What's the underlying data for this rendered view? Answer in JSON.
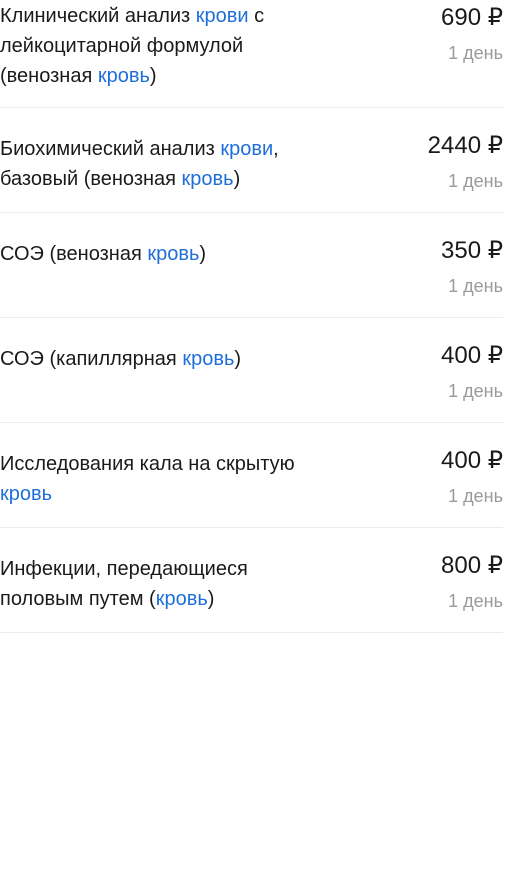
{
  "items": [
    {
      "title_parts": [
        "Клинический анализ ",
        "крови",
        " с лейкоцитарной формулой (венозная ",
        "кровь",
        ")"
      ],
      "price": "690 ₽",
      "duration": "1 день"
    },
    {
      "title_parts": [
        "Биохимический анализ ",
        "крови",
        ", базовый (венозная ",
        "кровь",
        ")"
      ],
      "price": "2440 ₽",
      "duration": "1 день"
    },
    {
      "title_parts": [
        "СОЭ (венозная ",
        "кровь",
        ")"
      ],
      "price": "350 ₽",
      "duration": "1 день"
    },
    {
      "title_parts": [
        "СОЭ (капиллярная ",
        "кровь",
        ")"
      ],
      "price": "400 ₽",
      "duration": "1 день"
    },
    {
      "title_parts": [
        "Исследования кала на скрытую ",
        "кровь"
      ],
      "price": "400 ₽",
      "duration": "1 день"
    },
    {
      "title_parts": [
        "Инфекции, передающиеся половым путем (",
        "кровь",
        ")"
      ],
      "price": "800 ₽",
      "duration": "1 день"
    }
  ]
}
